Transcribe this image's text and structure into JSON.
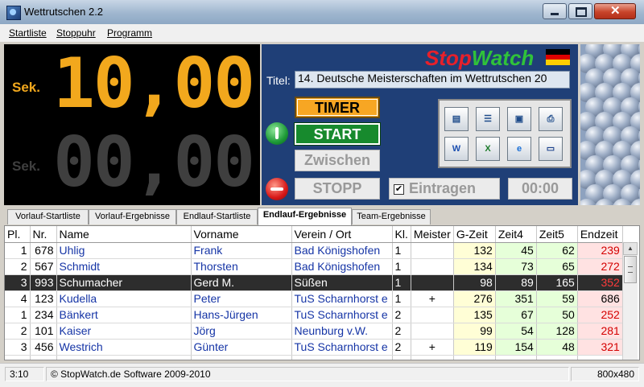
{
  "window": {
    "title": "Wettrutschen 2.2"
  },
  "menu": [
    "Startliste",
    "Stoppuhr",
    "Programm"
  ],
  "clock": {
    "unit_label": "Sek.",
    "main_time": "10,00",
    "secondary_time": "00,00",
    "main_color": "#f2a81d",
    "secondary_color": "#3f3f3f"
  },
  "controls": {
    "logo_stop": "Stop",
    "logo_watch": "Watch",
    "titel_label": "Titel:",
    "titel_value": "14. Deutsche Meisterschaften im Wettrutschen 20",
    "timer_label": "TIMER",
    "start_label": "START",
    "zwischen_label": "Zwischen",
    "stopp_label": "STOPP",
    "eintragen_label": "Eintragen",
    "eintragen_checked": true,
    "time_display": "00:00",
    "tool_icons": [
      "contact-card-icon",
      "document-list-icon",
      "save-disk-icon",
      "printer-icon",
      "word-icon",
      "excel-icon",
      "internet-explorer-icon",
      "monitor-icon"
    ]
  },
  "tabs": [
    "Vorlauf-Startliste",
    "Vorlauf-Ergebnisse",
    "Endlauf-Startliste",
    "Endlauf-Ergebnisse",
    "Team-Ergebnisse"
  ],
  "active_tab": "Endlauf-Ergebnisse",
  "table": {
    "columns": [
      "Pl.",
      "Nr.",
      "Name",
      "Vorname",
      "Verein / Ort",
      "Kl.",
      "Meister",
      "G-Zeit",
      "Zeit4",
      "Zeit5",
      "Endzeit"
    ],
    "rows": [
      [
        "1",
        "678",
        "Uhlig",
        "Frank",
        "Bad Königshofen",
        "1",
        "",
        "132",
        "45",
        "62",
        "239"
      ],
      [
        "2",
        "567",
        "Schmidt",
        "Thorsten",
        "Bad Königshofen",
        "1",
        "",
        "134",
        "73",
        "65",
        "272"
      ],
      [
        "3",
        "993",
        "Schumacher",
        "Gerd M.",
        "Süßen",
        "1",
        "",
        "98",
        "89",
        "165",
        "352"
      ],
      [
        "4",
        "123",
        "Kudella",
        "Peter",
        "TuS Scharnhorst e",
        "1",
        "+",
        "276",
        "351",
        "59",
        "686"
      ],
      [
        "1",
        "234",
        "Bänkert",
        "Hans-Jürgen",
        "TuS Scharnhorst e",
        "2",
        "",
        "135",
        "67",
        "50",
        "252"
      ],
      [
        "2",
        "101",
        "Kaiser",
        "Jörg",
        "Neunburg v.W.",
        "2",
        "",
        "99",
        "54",
        "128",
        "281"
      ],
      [
        "3",
        "456",
        "Westrich",
        "Günter",
        "TuS Scharnhorst e",
        "2",
        "+",
        "119",
        "154",
        "48",
        "321"
      ]
    ],
    "selected_row": 2
  },
  "status": {
    "time": "3:10",
    "copyright": "© StopWatch.de Software 2009-2010",
    "resolution": "800x480"
  }
}
